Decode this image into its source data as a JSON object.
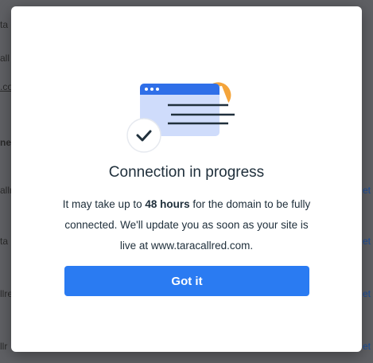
{
  "background": {
    "fragments": [
      "ta",
      "all",
      ".co",
      "ne",
      "alln",
      "ta",
      "llre",
      "llr",
      "et",
      "et",
      "et",
      "et"
    ]
  },
  "modal": {
    "title": "Connection in progress",
    "description": {
      "part1": "It may take up to ",
      "bold": "48 hours",
      "part2": " for the domain to be fully connected. We'll update you as soon as your site is live at www.taracallred.com."
    },
    "got_it_label": "Got it"
  },
  "colors": {
    "accent": "#2a7bf2",
    "illustration_blue": "#2f6fe8",
    "illustration_light": "#cfdcfb",
    "illustration_orange": "#f4a43a",
    "overlay": "#5f6064"
  },
  "icons": [
    "browser-window-icon",
    "checkmark-icon",
    "partial-circle-icon"
  ]
}
